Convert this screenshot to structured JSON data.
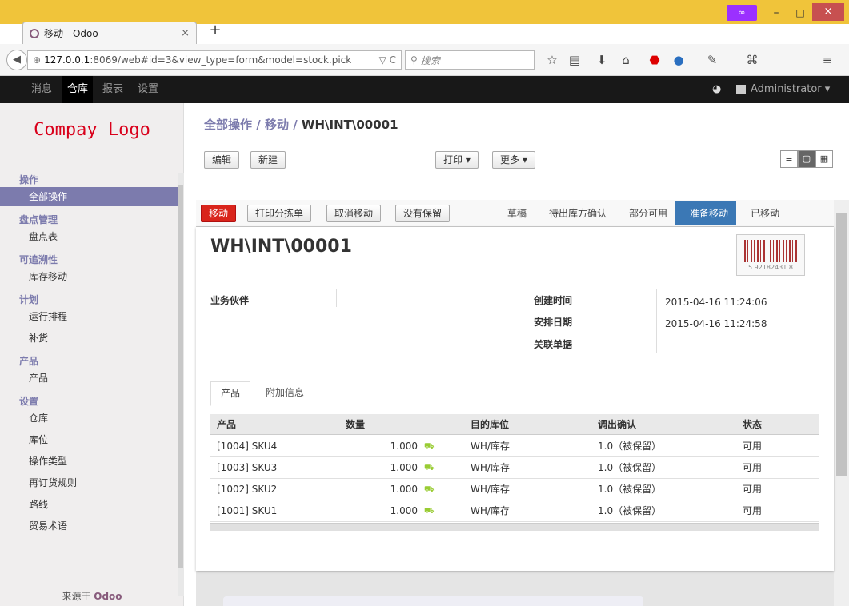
{
  "browser": {
    "tab_title": "移动 - Odoo",
    "tab_close": "×",
    "new_tab": "+",
    "url_host": "127.0.0.1",
    "url_rest": ":8069/web#id=3&view_type=form&model=stock.pick",
    "url_controls": "▽ C",
    "search_placeholder": "搜索",
    "mask_badge": "∞",
    "win_min": "–",
    "win_max": "□",
    "win_close": "×"
  },
  "topbar": {
    "menu": [
      "消息",
      "仓库",
      "报表",
      "设置"
    ],
    "active_index": 1,
    "user": "Administrator ▾"
  },
  "sidebar": {
    "logo": "Compay Logo",
    "sections": [
      {
        "title": "操作",
        "items": [
          "全部操作"
        ]
      },
      {
        "title": "盘点管理",
        "items": [
          "盘点表"
        ]
      },
      {
        "title": "可追溯性",
        "items": [
          "库存移动"
        ]
      },
      {
        "title": "计划",
        "items": [
          "运行排程",
          "补货"
        ]
      },
      {
        "title": "产品",
        "items": [
          "产品"
        ]
      },
      {
        "title": "设置",
        "items": [
          "仓库",
          "库位",
          "操作类型",
          "再订货规则",
          "路线",
          "贸易术语"
        ]
      }
    ],
    "active_item": "全部操作",
    "powered_prefix": "来源于 ",
    "powered_brand": "Odoo"
  },
  "breadcrumb": {
    "parts": [
      "全部操作",
      "移动"
    ],
    "sep": " / ",
    "current": "WH\\INT\\00001"
  },
  "toolbar": {
    "edit": "编辑",
    "create": "新建",
    "print": "打印 ▾",
    "more": "更多 ▾"
  },
  "header_buttons": {
    "move": "移动",
    "print_picking": "打印分拣单",
    "cancel": "取消移动",
    "unreserve": "没有保留"
  },
  "stages": [
    "草稿",
    "待出库方确认",
    "部分可用",
    "准备移动",
    "已移动"
  ],
  "current_stage": "准备移动",
  "record": {
    "name": "WH\\INT\\00001",
    "barcode_text": "5 92182431 8",
    "partner_label": "业务伙伴",
    "partner_value": "",
    "create_label": "创建时间",
    "create_value": "2015-04-16 11:24:06",
    "scheduled_label": "安排日期",
    "scheduled_value": "2015-04-16 11:24:58",
    "origin_label": "关联单据",
    "origin_value": ""
  },
  "tabs": [
    "产品",
    "附加信息"
  ],
  "table": {
    "headers": [
      "产品",
      "数量",
      "目的库位",
      "调出确认",
      "状态"
    ],
    "rows": [
      [
        "[1004] SKU4",
        "1.000",
        "WH/库存",
        "1.0（被保留）",
        "可用"
      ],
      [
        "[1003] SKU3",
        "1.000",
        "WH/库存",
        "1.0（被保留）",
        "可用"
      ],
      [
        "[1002] SKU2",
        "1.000",
        "WH/库存",
        "1.0（被保留）",
        "可用"
      ],
      [
        "[1001] SKU1",
        "1.000",
        "WH/库存",
        "1.0（被保留）",
        "可用"
      ]
    ]
  },
  "colors": {
    "accent": "#7c7bad",
    "red_button": "#d9241b",
    "stage_current": "#3b78b5",
    "title_bar": "#f0c43a"
  }
}
